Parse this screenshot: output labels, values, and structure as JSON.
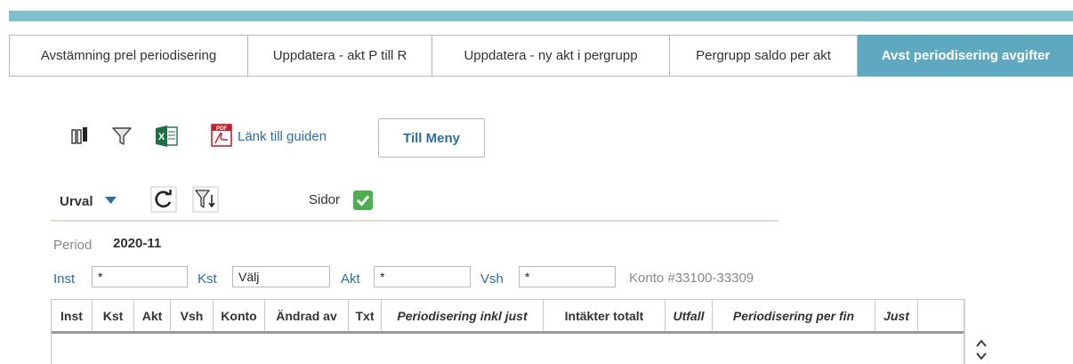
{
  "tabs": [
    {
      "label": "Avstämning prel periodisering",
      "active": false
    },
    {
      "label": "Uppdatera - akt P till R",
      "active": false
    },
    {
      "label": "Uppdatera - ny akt i pergrupp",
      "active": false
    },
    {
      "label": "Pergrupp saldo per akt",
      "active": false
    },
    {
      "label": "Avst periodisering avgifter",
      "active": true
    }
  ],
  "toolbar": {
    "guide_link": "Länk till guiden",
    "menu_button": "Till Meny"
  },
  "urval": {
    "label": "Urval",
    "sidor_label": "Sidor",
    "sidor_checked": true
  },
  "period": {
    "label": "Period",
    "value": "2020-11"
  },
  "filters": {
    "inst_label": "Inst",
    "inst_value": "*",
    "kst_label": "Kst",
    "kst_value": "Välj",
    "akt_label": "Akt",
    "akt_value": "*",
    "vsh_label": "Vsh",
    "vsh_value": "*",
    "konto_text": "Konto #33100-33309"
  },
  "grid": {
    "columns": [
      {
        "label": "Inst",
        "italic": false
      },
      {
        "label": "Kst",
        "italic": false
      },
      {
        "label": "Akt",
        "italic": false
      },
      {
        "label": "Vsh",
        "italic": false
      },
      {
        "label": "Konto",
        "italic": false
      },
      {
        "label": "Ändrad av",
        "italic": false
      },
      {
        "label": "Txt",
        "italic": false
      },
      {
        "label": "Periodisering inkl just",
        "italic": true
      },
      {
        "label": "Intäkter totalt",
        "italic": false
      },
      {
        "label": "Utfall",
        "italic": true
      },
      {
        "label": "Periodisering per fin",
        "italic": true
      },
      {
        "label": "Just",
        "italic": true
      }
    ]
  },
  "colors": {
    "accent": "#5fa9c0",
    "topbar": "#7fc0cd",
    "link": "#2a6ea6",
    "check": "#4caf50"
  }
}
